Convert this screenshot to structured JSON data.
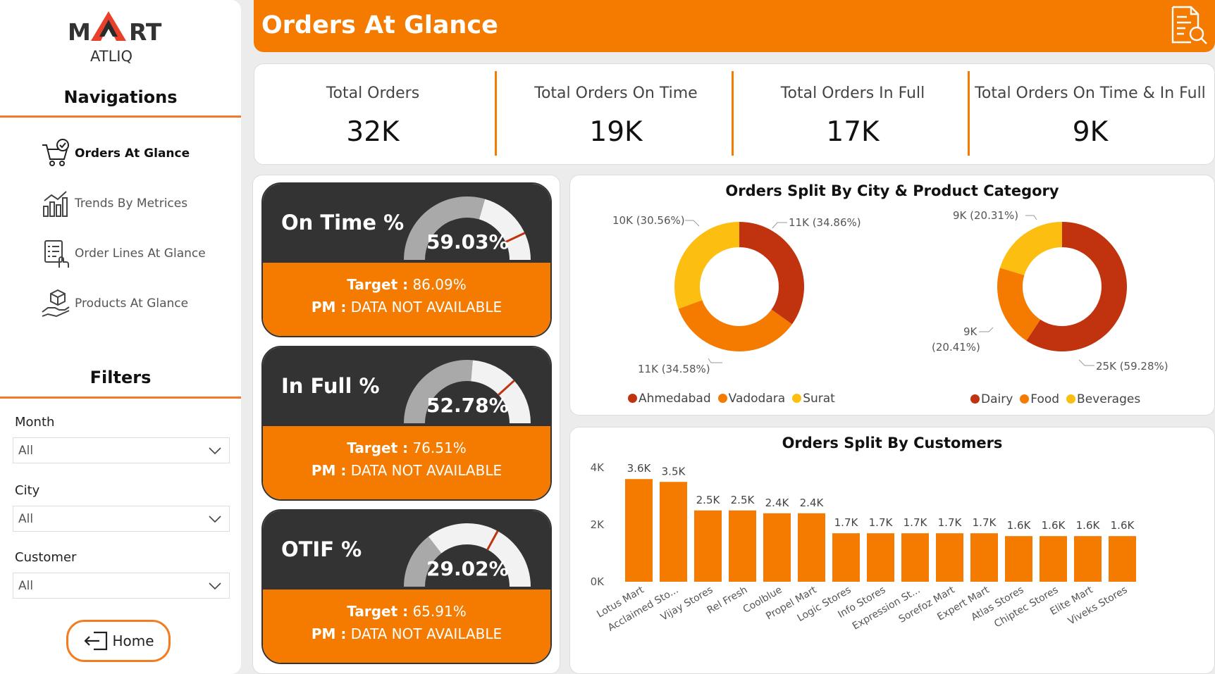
{
  "brand": {
    "logo_left": "M",
    "logo_right": "RT",
    "logo_sub": "ATLIQ"
  },
  "sidebar": {
    "nav_title": "Navigations",
    "nav_items": [
      {
        "label": "Orders At Glance",
        "icon": "cart-check-icon",
        "active": true
      },
      {
        "label": "Trends By Metrices",
        "icon": "bar-trend-icon",
        "active": false
      },
      {
        "label": "Order Lines At Glance",
        "icon": "checklist-hand-icon",
        "active": false
      },
      {
        "label": "Products At Glance",
        "icon": "box-hand-icon",
        "active": false
      }
    ],
    "filters_title": "Filters",
    "filters": [
      {
        "label": "Month",
        "value": "All"
      },
      {
        "label": "City",
        "value": "All"
      },
      {
        "label": "Customer",
        "value": "All"
      }
    ],
    "home_label": "Home"
  },
  "header": {
    "title": "Orders At Glance",
    "icon": "report-search-icon"
  },
  "kpis": [
    {
      "label": "Total Orders",
      "value": "32K"
    },
    {
      "label": "Total Orders On Time",
      "value": "19K"
    },
    {
      "label": "Total Orders In Full",
      "value": "17K"
    },
    {
      "label": "Total Orders On Time & In Full",
      "value": "9K"
    }
  ],
  "gauges": [
    {
      "title": "On Time %",
      "value_text": "59.03%",
      "value": 59.03,
      "target": 86.09,
      "target_label": "Target :",
      "target_text": "86.09%",
      "pm_label": "PM :",
      "pm_text": "DATA NOT AVAILABLE"
    },
    {
      "title": "In Full %",
      "value_text": "52.78%",
      "value": 52.78,
      "target": 76.51,
      "target_label": "Target :",
      "target_text": "76.51%",
      "pm_label": "PM :",
      "pm_text": "DATA NOT AVAILABLE"
    },
    {
      "title": "OTIF %",
      "value_text": "29.02%",
      "value": 29.02,
      "target": 65.91,
      "target_label": "Target :",
      "target_text": "65.91%",
      "pm_label": "PM :",
      "pm_text": "DATA NOT AVAILABLE"
    }
  ],
  "colors": {
    "accent": "#f47b00",
    "dark": "#333333",
    "red": "#c1330e",
    "orange": "#f47b00",
    "yellow": "#fcbf11"
  },
  "donuts": {
    "title": "Orders Split By City & Product Category",
    "city": {
      "slices": [
        {
          "name": "Ahmedabad",
          "value": 34.86,
          "label": "11K (34.86%)",
          "color": "#c1330e"
        },
        {
          "name": "Vadodara",
          "value": 34.58,
          "label": "11K (34.58%)",
          "color": "#f47b00"
        },
        {
          "name": "Surat",
          "value": 30.56,
          "label": "10K (30.56%)",
          "color": "#fcbf11"
        }
      ]
    },
    "category": {
      "slices": [
        {
          "name": "Dairy",
          "value": 59.28,
          "label": "25K (59.28%)",
          "color": "#c1330e"
        },
        {
          "name": "Food",
          "value": 20.41,
          "label_a": "9K",
          "label_b": "(20.41%)",
          "color": "#f47b00"
        },
        {
          "name": "Beverages",
          "value": 20.31,
          "label": "9K (20.31%)",
          "color": "#fcbf11"
        }
      ]
    }
  },
  "chart_data": {
    "type": "bar",
    "title": "Orders Split By Customers",
    "categories": [
      "Lotus Mart",
      "Acclaimed Sto...",
      "Vijay Stores",
      "Rel Fresh",
      "Coolblue",
      "Propel Mart",
      "Logic Stores",
      "Info Stores",
      "Expression St...",
      "Sorefoz Mart",
      "Expert Mart",
      "Atlas Stores",
      "Chiptec Stores",
      "Elite Mart",
      "Viveks Stores"
    ],
    "values": [
      3.6,
      3.5,
      2.5,
      2.5,
      2.4,
      2.4,
      1.7,
      1.7,
      1.7,
      1.7,
      1.7,
      1.6,
      1.6,
      1.6,
      1.6
    ],
    "data_labels": [
      "3.6K",
      "3.5K",
      "2.5K",
      "2.5K",
      "2.4K",
      "2.4K",
      "1.7K",
      "1.7K",
      "1.7K",
      "1.7K",
      "1.7K",
      "1.6K",
      "1.6K",
      "1.6K",
      "1.6K"
    ],
    "yticks": [
      "0K",
      "2K",
      "4K"
    ],
    "ylim": [
      0,
      4
    ],
    "color": "#f47b00"
  }
}
